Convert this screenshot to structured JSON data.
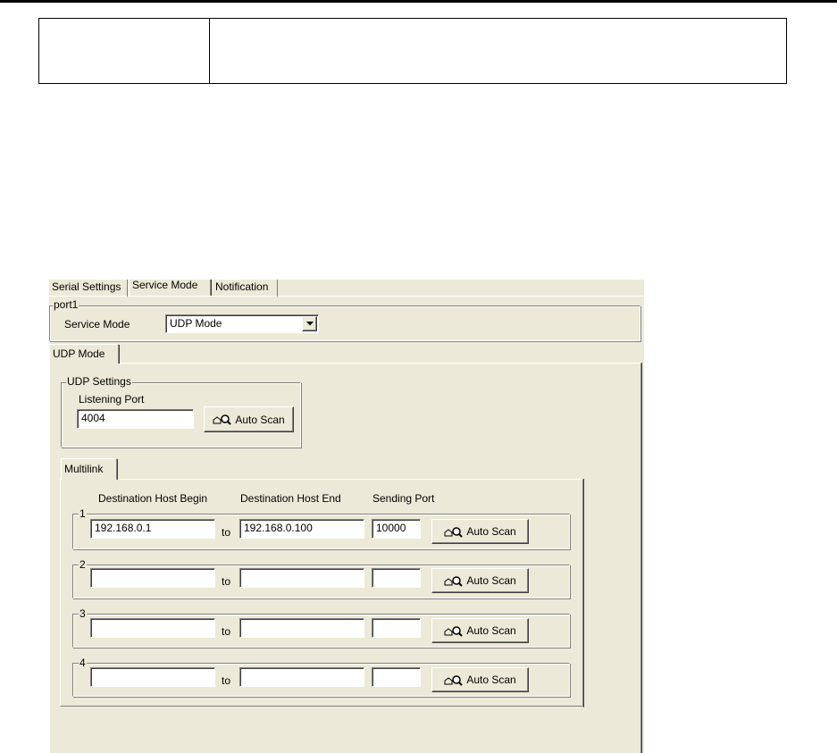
{
  "dialog": {
    "tabs": [
      {
        "label": "Serial Settings",
        "active": false
      },
      {
        "label": "Service Mode",
        "active": true
      },
      {
        "label": "Notification",
        "active": false
      }
    ],
    "port_group": {
      "title": "port1",
      "service_mode_label": "Service Mode",
      "service_mode_value": "UDP Mode"
    },
    "mode_tab": {
      "label": "UDP Mode"
    },
    "udp_settings": {
      "title": "UDP Settings",
      "listening_port_label": "Listening Port",
      "listening_port_value": "4004",
      "auto_scan_label": "Auto Scan"
    },
    "multilink": {
      "tab_label": "Multilink",
      "col_begin": "Destination Host Begin",
      "col_end": "Destination Host End",
      "col_port": "Sending Port",
      "to_label": "to",
      "auto_scan_label": "Auto Scan",
      "rows": [
        {
          "number": "1",
          "begin": "192.168.0.1",
          "end": "192.168.0.100",
          "port": "10000"
        },
        {
          "number": "2",
          "begin": "",
          "end": "",
          "port": ""
        },
        {
          "number": "3",
          "begin": "",
          "end": "",
          "port": ""
        },
        {
          "number": "4",
          "begin": "",
          "end": "",
          "port": ""
        }
      ]
    }
  }
}
